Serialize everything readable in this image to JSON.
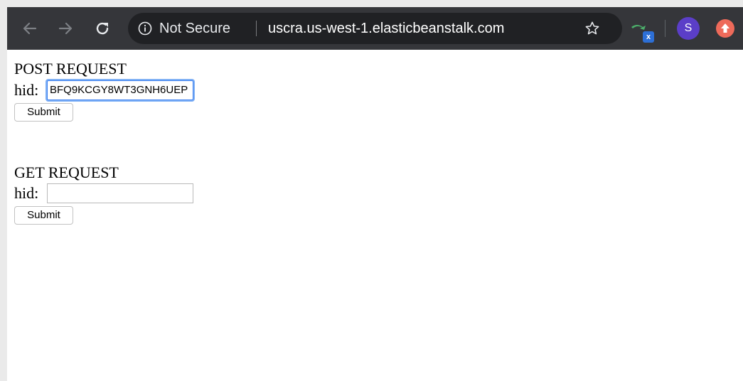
{
  "browser": {
    "security_label": "Not Secure",
    "url": "uscra.us-west-1.elasticbeanstalk.com",
    "extension_badge": "x",
    "profile_initial": "S",
    "icons": {
      "back": "back-arrow-icon",
      "forward": "forward-arrow-icon",
      "reload": "reload-icon",
      "info": "info-icon",
      "bookmark": "star-icon",
      "extension": "extension-icon",
      "update": "update-icon"
    },
    "colors": {
      "toolbar": "#35363a",
      "omnibox": "#202124",
      "avatar": "#5b3ec8",
      "update": "#ee6a5a",
      "focus_ring": "#3b7ff0"
    }
  },
  "page": {
    "post_form": {
      "heading": "POST REQUEST",
      "field_label": "hid:",
      "field_value": "BFQ9KCGY8WT3GNH6UEP",
      "submit_label": "Submit"
    },
    "get_form": {
      "heading": "GET REQUEST",
      "field_label": "hid:",
      "field_value": "",
      "submit_label": "Submit"
    }
  }
}
